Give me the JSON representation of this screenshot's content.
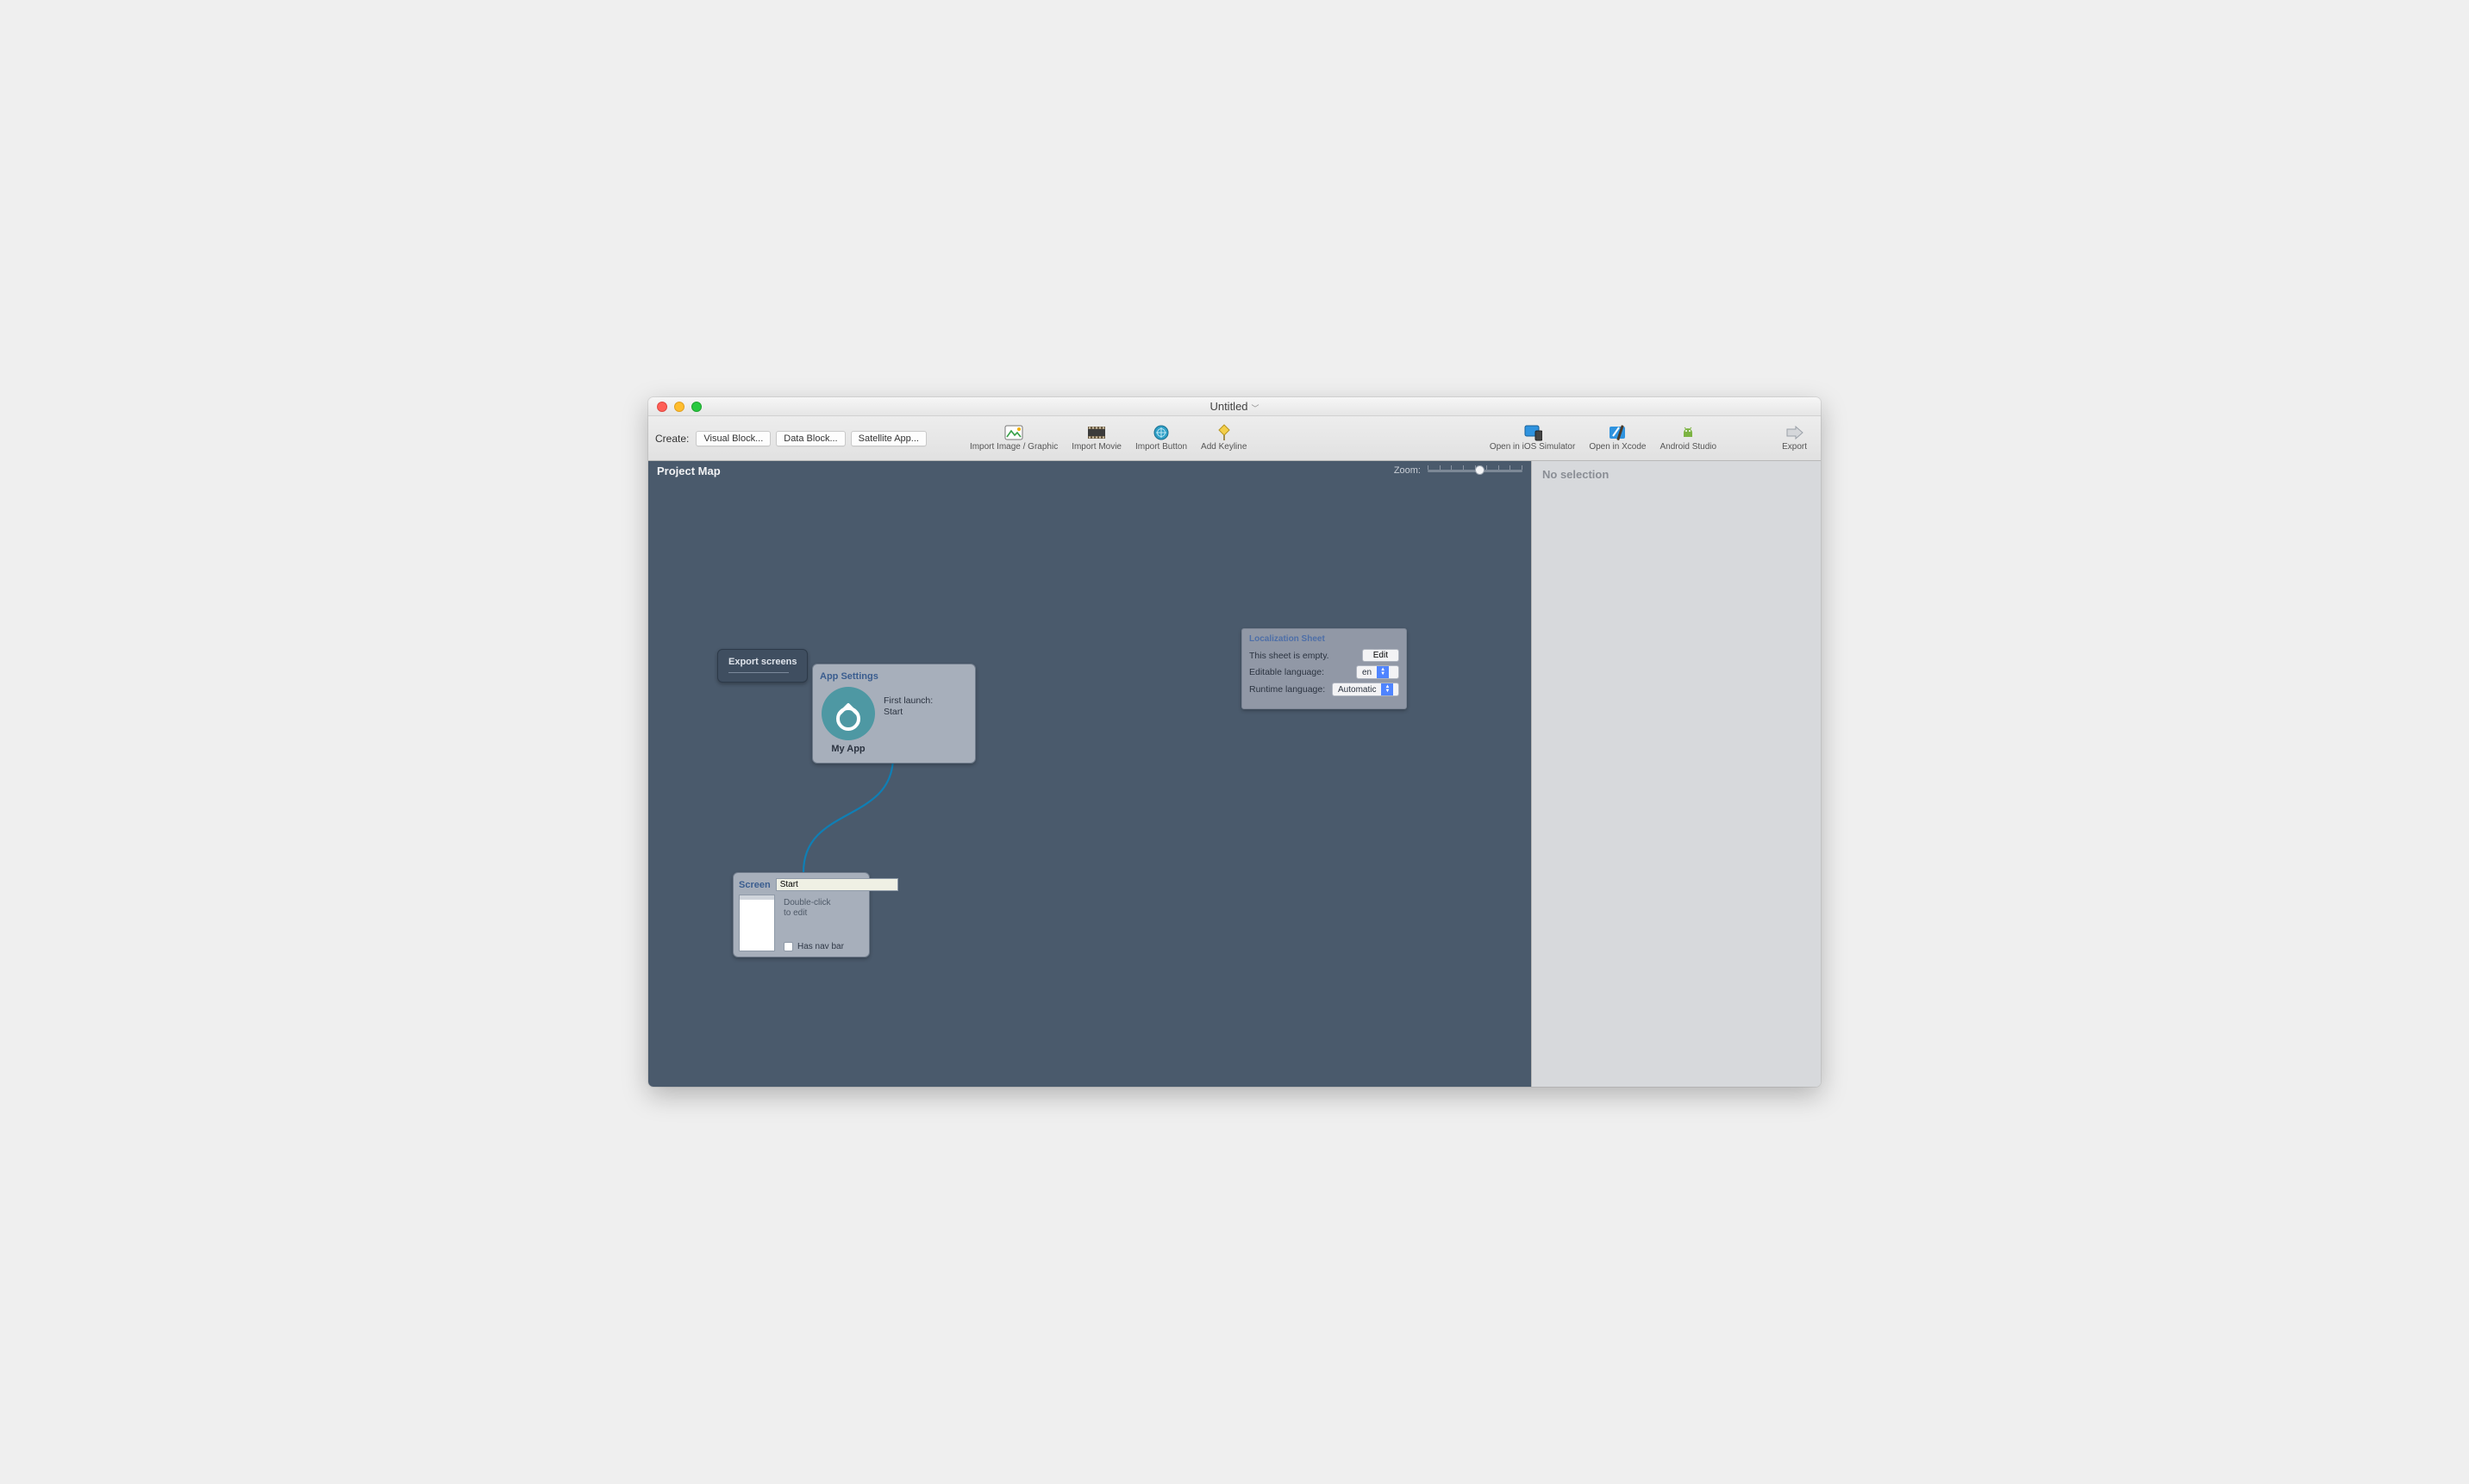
{
  "window": {
    "title": "Untitled"
  },
  "toolbar": {
    "create_label": "Create:",
    "buttons": {
      "visual_block": "Visual Block...",
      "data_block": "Data Block...",
      "satellite_app": "Satellite App..."
    },
    "tools": {
      "import_image": "Import Image / Graphic",
      "import_movie": "Import Movie",
      "import_button": "Import Button",
      "add_keyline": "Add Keyline"
    },
    "right": {
      "open_ios_sim": "Open in iOS Simulator",
      "open_xcode": "Open in Xcode",
      "android_studio": "Android Studio",
      "export": "Export"
    }
  },
  "canvas": {
    "title": "Project Map",
    "zoom_label": "Zoom:",
    "zoom_value_pct": 50
  },
  "inspector": {
    "placeholder": "No selection"
  },
  "nodes": {
    "export_screens": {
      "label": "Export screens"
    },
    "app_settings": {
      "title": "App Settings",
      "first_launch_label": "First launch:",
      "first_launch_value": "Start",
      "app_name": "My App"
    },
    "screen": {
      "title": "Screen",
      "name": "Start",
      "hint_line1": "Double-click",
      "hint_line2": "to edit",
      "has_nav_bar_label": "Has nav bar",
      "has_nav_bar_checked": false
    },
    "localization": {
      "title": "Localization Sheet",
      "empty_msg": "This sheet is empty.",
      "edit_label": "Edit",
      "editable_lang_label": "Editable language:",
      "editable_lang_value": "en",
      "runtime_lang_label": "Runtime language:",
      "runtime_lang_value": "Automatic"
    }
  }
}
